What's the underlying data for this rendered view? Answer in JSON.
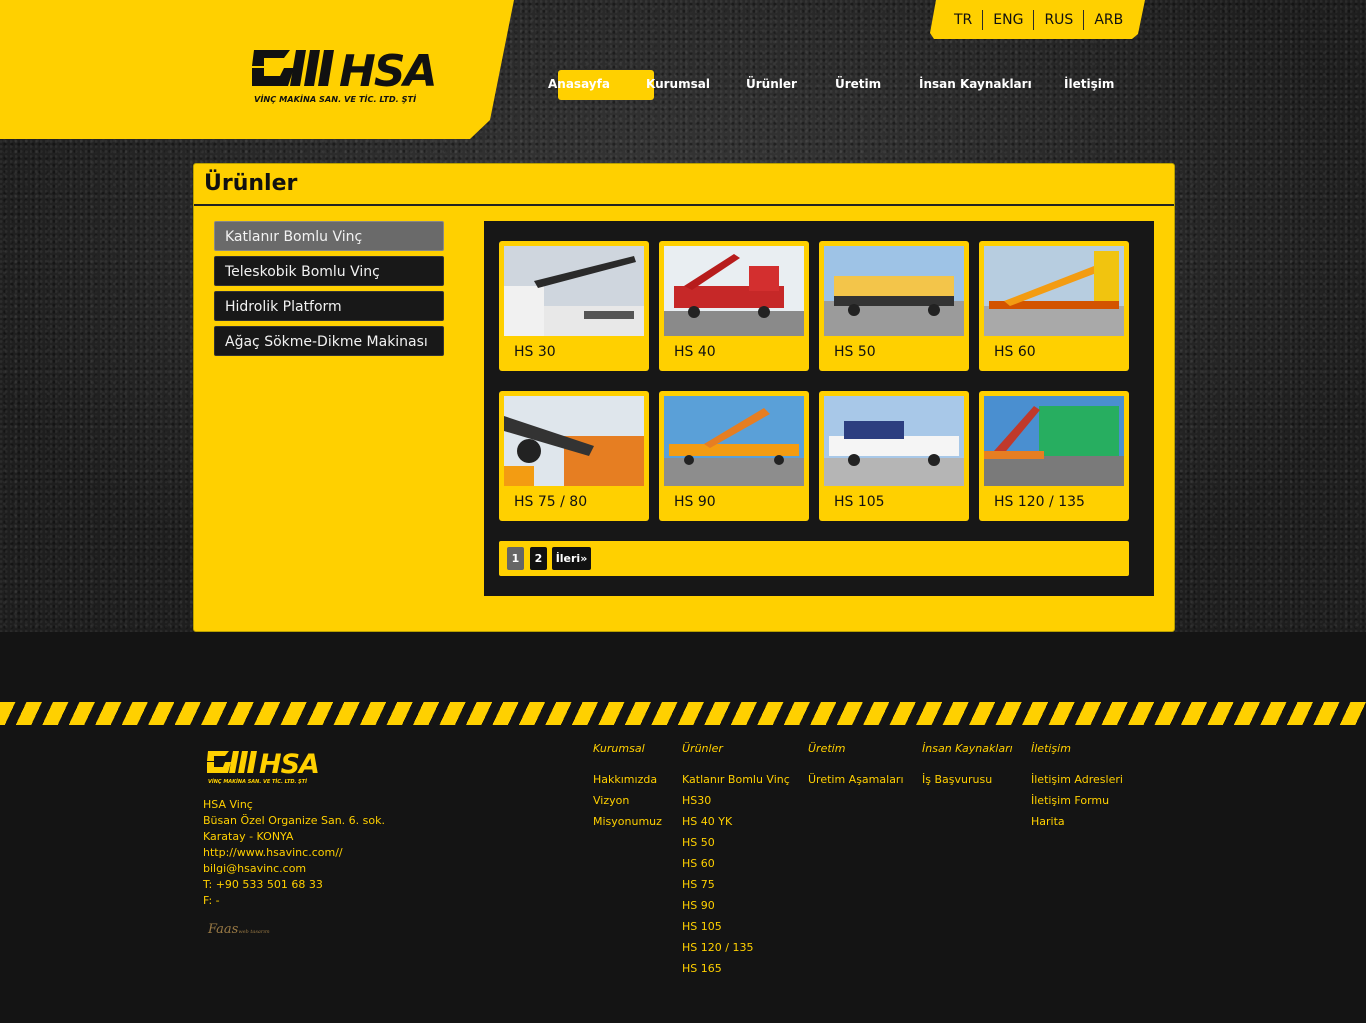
{
  "brand": {
    "logo_text": "HSA",
    "logo_subtitle": "VİNÇ MAKİNA SAN. VE TİC. LTD. ŞTİ",
    "accent": "#ffd000",
    "dark": "#141414"
  },
  "languages": [
    "TR",
    "ENG",
    "RUS",
    "ARB"
  ],
  "nav": {
    "items": [
      "Anasayfa",
      "Kurumsal",
      "Ürünler",
      "Üretim",
      "İnsan Kaynakları",
      "İletişim"
    ],
    "active": "Anasayfa"
  },
  "page": {
    "title": "Ürünler"
  },
  "categories": [
    {
      "label": "Katlanır Bomlu Vinç",
      "active": true
    },
    {
      "label": "Teleskobik Bomlu Vinç",
      "active": false
    },
    {
      "label": "Hidrolik Platform",
      "active": false
    },
    {
      "label": "Ağaç Sökme-Dikme Makinası",
      "active": false
    }
  ],
  "products": [
    {
      "name": "HS 30"
    },
    {
      "name": "HS 40"
    },
    {
      "name": "HS 50"
    },
    {
      "name": "HS 60"
    },
    {
      "name": "HS 75 / 80"
    },
    {
      "name": "HS 90"
    },
    {
      "name": "HS 105"
    },
    {
      "name": "HS 120 / 135"
    }
  ],
  "pagination": {
    "pages": [
      "1",
      "2"
    ],
    "current": "1",
    "next": "İleri»"
  },
  "footer": {
    "address": {
      "company": "HSA Vinç",
      "line1": "Büsan Özel Organize San. 6. sok.",
      "line2": "Karatay - KONYA",
      "web": "http://www.hsavinc.com//",
      "email": "bilgi@hsavinc.com",
      "phone": "T: +90 533 501 68 33",
      "fax": "F: -"
    },
    "maker_credit": {
      "name": "Faas",
      "tag": "web tasarım"
    },
    "columns": [
      {
        "title": "Kurumsal",
        "links": [
          "Hakkımızda",
          "Vizyon",
          "Misyonumuz"
        ]
      },
      {
        "title": "Ürünler",
        "links": [
          "Katlanır Bomlu Vinç",
          "HS30",
          "HS 40 YK",
          "HS 50",
          "HS 60",
          "HS 75",
          "HS 90",
          "HS 105",
          "HS 120 / 135",
          "HS 165"
        ]
      },
      {
        "title": "Üretim",
        "links": [
          "Üretim Aşamaları"
        ]
      },
      {
        "title": "İnsan Kaynakları",
        "links": [
          "İş Başvurusu"
        ]
      },
      {
        "title": "İletişim",
        "links": [
          "İletişim Adresleri",
          "İletişim Formu",
          "Harita"
        ]
      }
    ]
  }
}
